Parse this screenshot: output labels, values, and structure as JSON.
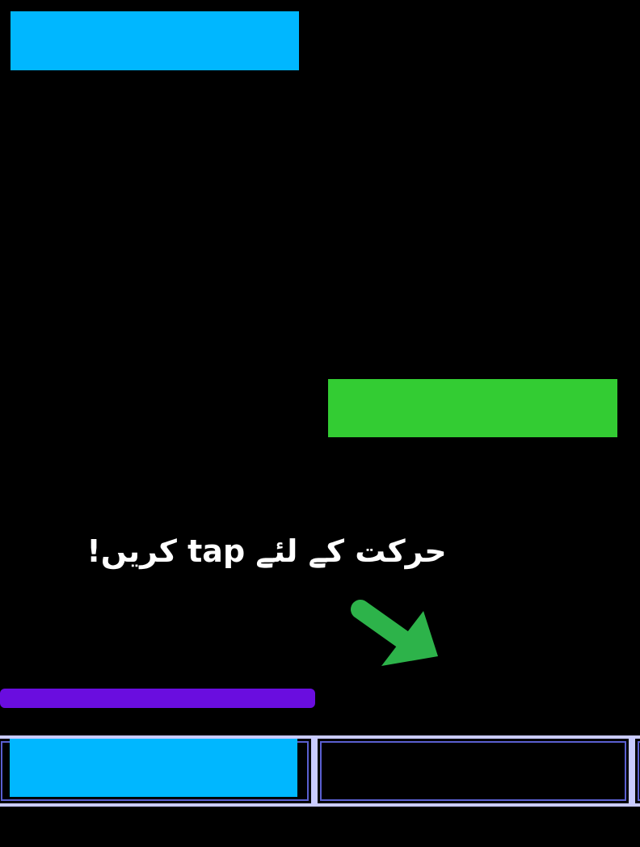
{
  "game": {
    "hint_text": "حرکت کے لئے tap کریں!",
    "colors": {
      "background": "#000000",
      "block_blue": "#00b7ff",
      "block_green": "#33cc33",
      "player_bar": "#6a0ddf",
      "arrow": "#2db34a",
      "lane_border": "#c9cbff",
      "lane_fill": "#00b7ff"
    },
    "icons": {
      "hint_arrow": "arrow-down-right-icon"
    },
    "lane_slots_filled": [
      true,
      false,
      false
    ]
  }
}
